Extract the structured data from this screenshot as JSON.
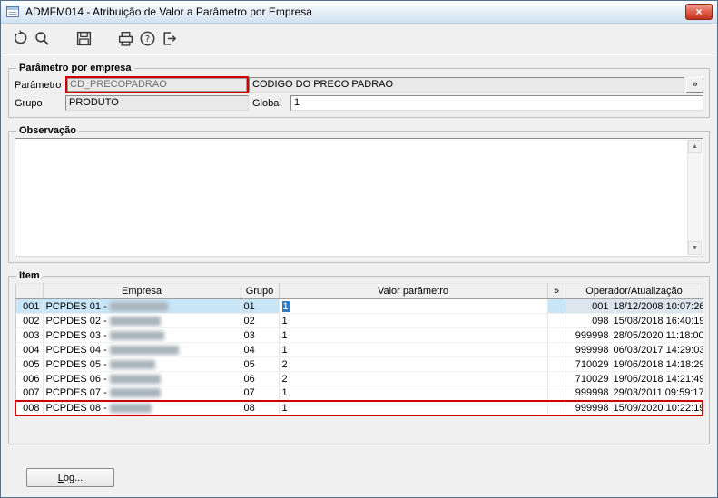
{
  "window": {
    "title": "ADMFM014 - Atribuição de Valor a Parâmetro por Empresa",
    "close_glyph": "×"
  },
  "toolbar": {
    "buttons": [
      {
        "name": "undo-button",
        "icon": "undo-icon"
      },
      {
        "name": "search-button",
        "icon": "search-icon"
      },
      {
        "name": "save-button",
        "icon": "save-icon"
      },
      {
        "name": "print-button",
        "icon": "print-icon"
      },
      {
        "name": "help-button",
        "icon": "help-icon"
      },
      {
        "name": "exit-button",
        "icon": "exit-icon"
      }
    ]
  },
  "param_group": {
    "title": "Parâmetro por empresa",
    "parametro_label": "Parâmetro",
    "parametro_value": "CD_PRECOPADRAO",
    "parametro_desc": "CODIGO DO PRECO PADRAO",
    "lookup_button": "»",
    "grupo_label": "Grupo",
    "grupo_value": "PRODUTO",
    "global_label": "Global",
    "global_value": "1"
  },
  "observacao_group": {
    "title": "Observação",
    "value": "",
    "scroll_up_glyph": "▲",
    "scroll_down_glyph": "▼"
  },
  "item_group": {
    "title": "Item",
    "headers": {
      "num": "",
      "empresa": "Empresa",
      "grupo": "Grupo",
      "valor": "Valor parâmetro",
      "expand": "»",
      "operador": "Operador/Atualização"
    },
    "rows": [
      {
        "num": "001",
        "empresa": "PCPDES 01 -",
        "redacted": true,
        "grupo": "01",
        "valor": "1",
        "operador": "001",
        "atualizacao": "18/12/2008 10:07:26",
        "selected": true
      },
      {
        "num": "002",
        "empresa": "PCPDES 02 -",
        "redacted": true,
        "grupo": "02",
        "valor": "1",
        "operador": "098",
        "atualizacao": "15/08/2018 16:40:19"
      },
      {
        "num": "003",
        "empresa": "PCPDES 03 -",
        "redacted": true,
        "grupo": "03",
        "valor": "1",
        "operador": "999998",
        "atualizacao": "28/05/2020 11:18:00"
      },
      {
        "num": "004",
        "empresa": "PCPDES 04 -",
        "redacted": true,
        "grupo": "04",
        "valor": "1",
        "operador": "999998",
        "atualizacao": "06/03/2017 14:29:03"
      },
      {
        "num": "005",
        "empresa": "PCPDES 05 -",
        "redacted": true,
        "grupo": "05",
        "valor": "2",
        "operador": "710029",
        "atualizacao": "19/06/2018 14:18:29"
      },
      {
        "num": "006",
        "empresa": "PCPDES 06 -",
        "redacted": true,
        "grupo": "06",
        "valor": "2",
        "operador": "710029",
        "atualizacao": "19/06/2018 14:21:49"
      },
      {
        "num": "007",
        "empresa": "PCPDES 07 -",
        "redacted": true,
        "grupo": "07",
        "valor": "1",
        "operador": "999998",
        "atualizacao": "29/03/2011 09:59:17"
      },
      {
        "num": "008",
        "empresa": "PCPDES 08 -",
        "redacted": true,
        "grupo": "08",
        "valor": "1",
        "operador": "999998",
        "atualizacao": "15/09/2020 10:22:19",
        "highlighted": true
      }
    ]
  },
  "footer": {
    "log_button": "Log..."
  },
  "colors": {
    "annotation_red": "#d10000",
    "row_selection": "#c8e6f8",
    "close_button_red": "#c22f1e",
    "titlebar_gradient_bottom": "#d2e2f1"
  }
}
